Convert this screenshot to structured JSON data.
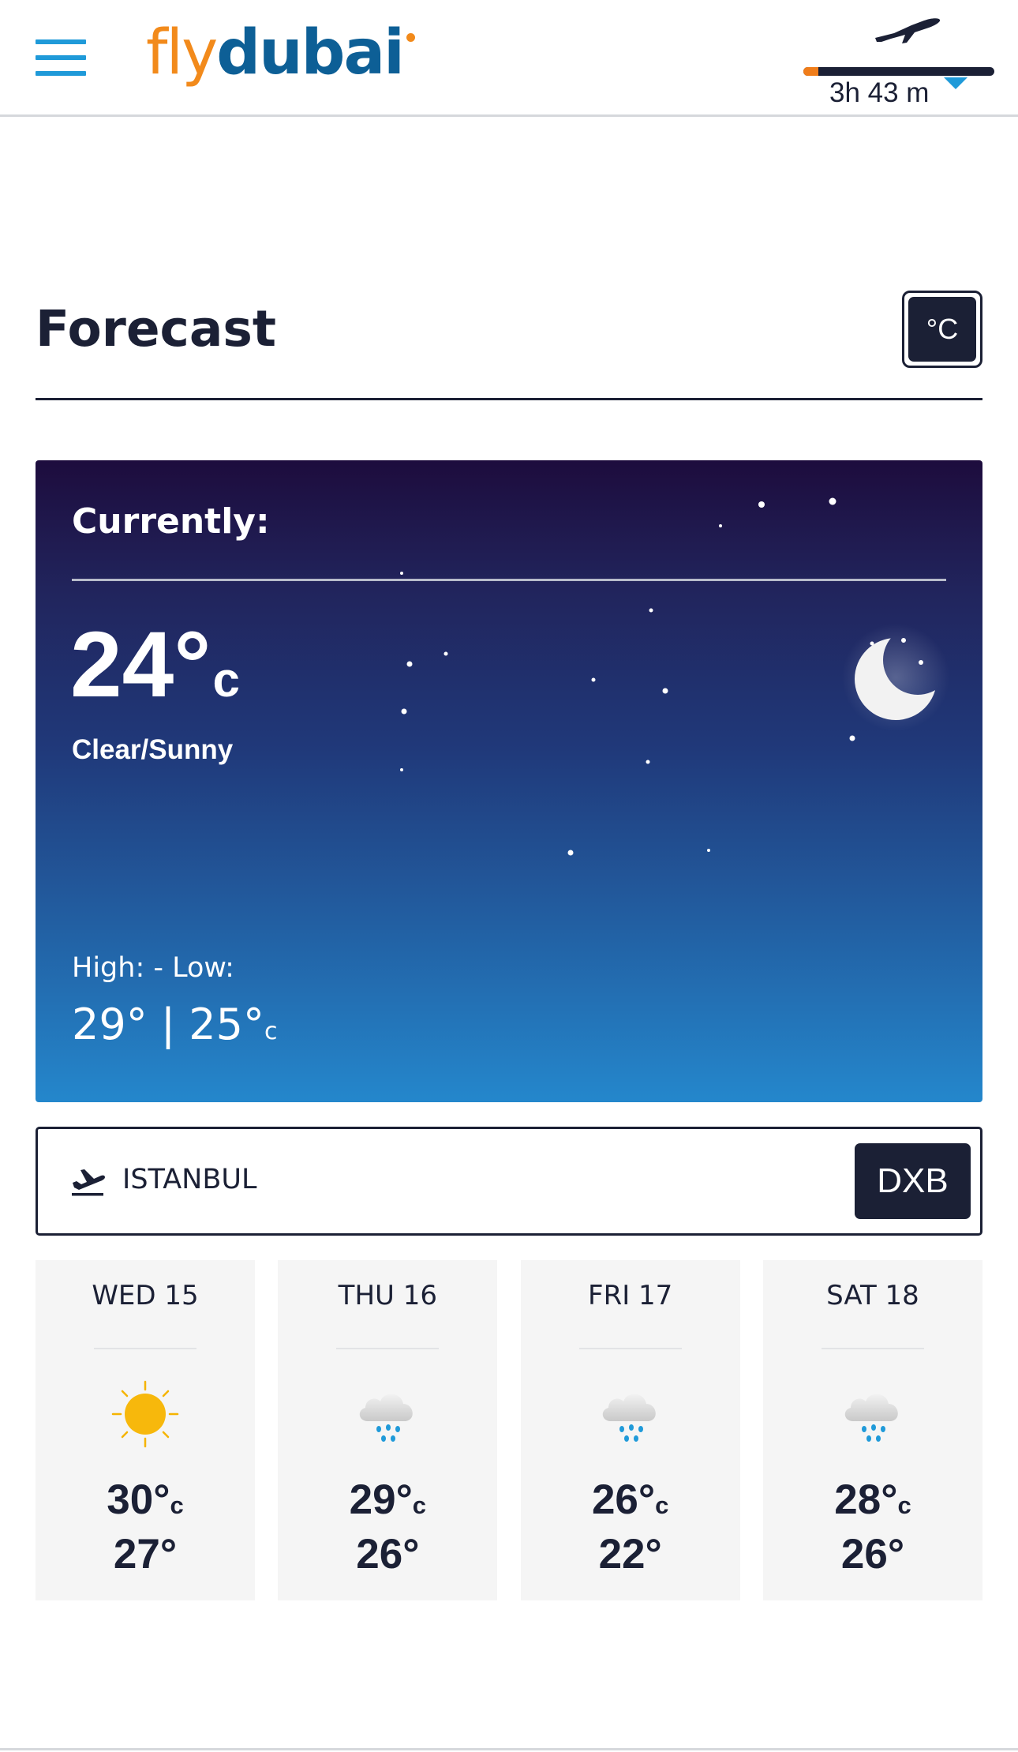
{
  "header": {
    "logo": {
      "fly": "fly",
      "dubai": "dubai"
    },
    "flight_progress": {
      "duration": "3h 43 m",
      "progress_fraction": 0.08
    },
    "colors": {
      "brand_orange": "#f28a1b",
      "brand_blue": "#0d5f96",
      "accent_blue": "#1f9ad9",
      "navy": "#1b2035"
    }
  },
  "forecast": {
    "title": "Forecast",
    "unit_toggle": "°C"
  },
  "current": {
    "label": "Currently:",
    "temperature": "24°",
    "unit": "c",
    "condition": "Clear/Sunny",
    "high_low_label": "High: - Low:",
    "high_low_values": "29° | 25°",
    "high_low_unit": "c",
    "icon": "moon-icon"
  },
  "location": {
    "icon": "takeoff-icon",
    "city": "ISTANBUL",
    "airport_code": "DXB"
  },
  "days": [
    {
      "label": "WED 15",
      "high": "30°",
      "unit": "c",
      "low": "27°",
      "icon": "sun-icon"
    },
    {
      "label": "THU 16",
      "high": "29°",
      "unit": "c",
      "low": "26°",
      "icon": "rain-cloud-icon"
    },
    {
      "label": "FRI 17",
      "high": "26°",
      "unit": "c",
      "low": "22°",
      "icon": "rain-cloud-icon"
    },
    {
      "label": "SAT 18",
      "high": "28°",
      "unit": "c",
      "low": "26°",
      "icon": "rain-cloud-icon"
    }
  ]
}
